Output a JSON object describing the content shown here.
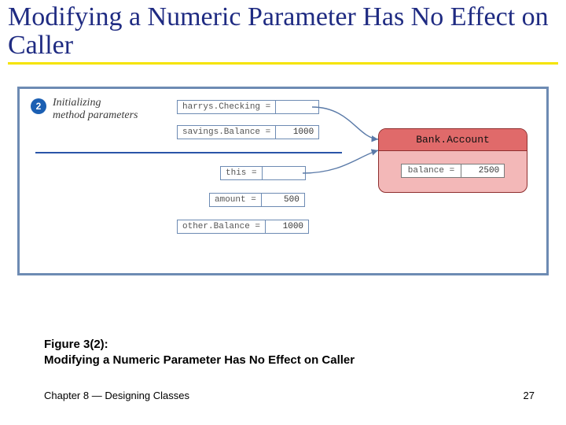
{
  "title": "Modifying a Numeric Parameter Has No Effect on Caller",
  "figure": {
    "step_number": "2",
    "step_label_line1": "Initializing",
    "step_label_line2": "method parameters",
    "vars": {
      "harrysChecking": {
        "label": "harrys.Checking =",
        "value": ""
      },
      "savingsBalance": {
        "label": "savings.Balance =",
        "value": "1000"
      },
      "this": {
        "label": "this =",
        "value": ""
      },
      "amount": {
        "label": "amount =",
        "value": "500"
      },
      "otherBalance": {
        "label": "other.Balance =",
        "value": "1000"
      }
    },
    "object": {
      "class_name": "Bank.Account",
      "field_label": "balance =",
      "field_value": "2500"
    }
  },
  "caption_line1": "Figure 3(2):",
  "caption_line2": "Modifying a Numeric Parameter Has No Effect on Caller",
  "footer_chapter": "Chapter 8 ⯣ Designing Classes",
  "footer_chapter_plain": "Chapter 8 — Designing Classes",
  "page_number": "27"
}
